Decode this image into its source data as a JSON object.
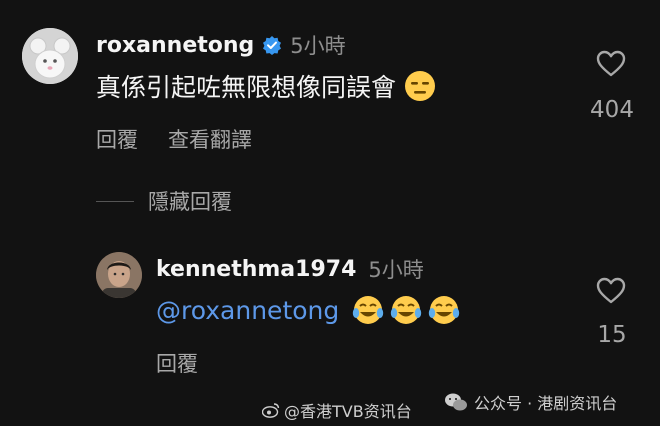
{
  "comment": {
    "username": "roxannetong",
    "time": "5小時",
    "text": "真係引起咗無限想像同誤會",
    "like_count": "404",
    "reply_label": "回覆",
    "translate_label": "查看翻譯",
    "hide_replies_label": "隱藏回覆"
  },
  "reply": {
    "username": "kennethma1974",
    "time": "5小時",
    "mention": "@roxannetong",
    "like_count": "15",
    "reply_label": "回覆"
  },
  "watermarks": {
    "left": "@香港TVB资讯台",
    "right": "公众号 · 港剧资讯台"
  },
  "colors": {
    "background": "#121212",
    "mention": "#5d98e8",
    "verified": "#3797f0"
  }
}
